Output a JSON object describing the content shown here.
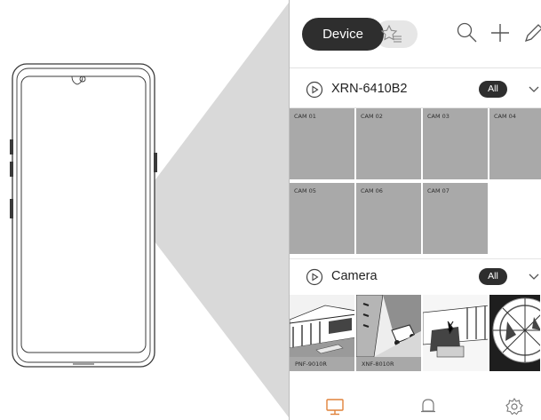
{
  "header": {
    "device_tab": "Device",
    "favorite_icon": "star-list-icon",
    "search_icon": "search-icon",
    "add_icon": "plus-icon",
    "edit_icon": "pencil-icon"
  },
  "sections": [
    {
      "title": "XRN-6410B2",
      "filter": "All",
      "icon": "play-circle-icon",
      "cameras": [
        "CAM 01",
        "CAM 02",
        "CAM 03",
        "CAM 04",
        "CAM 05",
        "CAM 06",
        "CAM 07"
      ]
    },
    {
      "title": "Camera",
      "filter": "All",
      "icon": "play-circle-icon",
      "thumbnails": [
        "PNF-9010R",
        "XNF-8010R",
        "",
        ""
      ]
    }
  ],
  "bottom_nav": [
    "monitor-icon",
    "bell-icon",
    "gear-icon"
  ],
  "colors": {
    "pill_dark": "#2e2e2e",
    "tile_gray": "#a9a9a9",
    "beam_gray": "#d9d9d9"
  }
}
